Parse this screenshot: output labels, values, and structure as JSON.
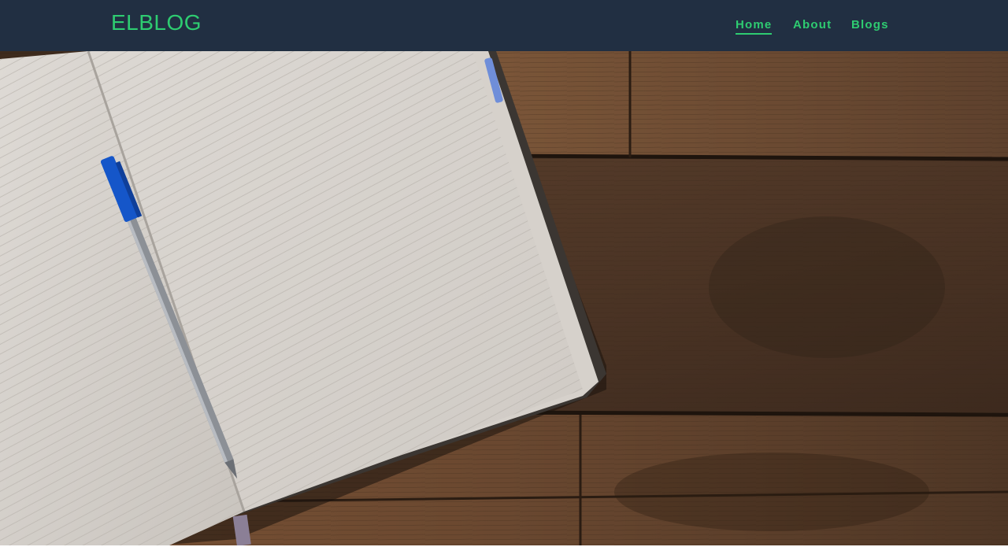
{
  "header": {
    "logo": "ELBLOG",
    "nav": [
      {
        "label": "Home",
        "active": true
      },
      {
        "label": "About",
        "active": false
      },
      {
        "label": "Blogs",
        "active": false
      }
    ]
  },
  "hero": {
    "image": "hero-photo",
    "description_icon": "notebook-and-pen-on-wooden-table"
  },
  "colors": {
    "navbar_bg": "#212f42",
    "accent": "#2ecc71"
  }
}
